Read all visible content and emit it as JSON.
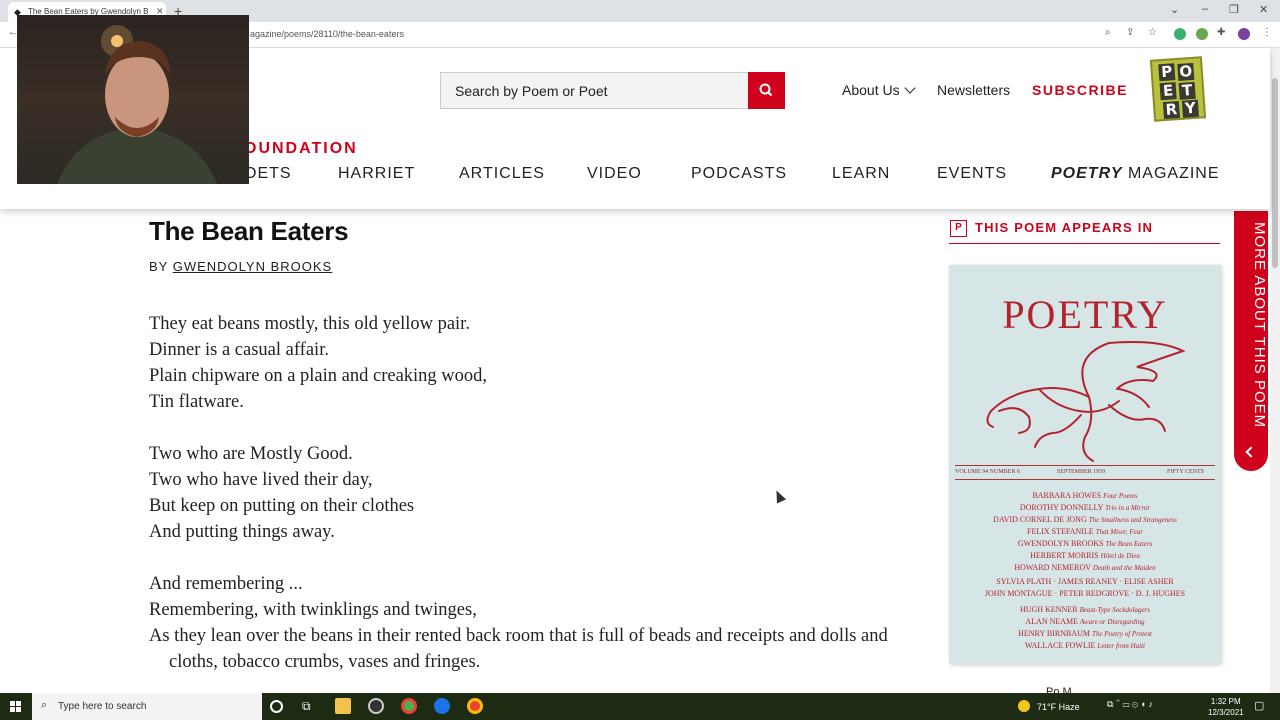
{
  "browser": {
    "tab_title": "The Bean Eaters by Gwendolyn B",
    "url": "agazine/poems/28110/the-bean-eaters"
  },
  "header": {
    "search_placeholder": "Search by Poem or Poet",
    "about_us": "About Us",
    "newsletters": "Newsletters",
    "subscribe": "SUBSCRIBE",
    "logo_letters": [
      "P",
      "O",
      "E",
      "T",
      "R",
      "Y"
    ],
    "foundation_fragment": "OUNDATION",
    "nav": {
      "poets_fragment": "OETS",
      "harriet": "HARRIET",
      "articles": "ARTICLES",
      "video": "VIDEO",
      "podcasts": "PODCASTS",
      "learn": "LEARN",
      "events": "EVENTS",
      "poetry_magazine_em": "POETRY",
      "poetry_magazine_rest": " MAGAZINE"
    }
  },
  "poem": {
    "title": "The Bean Eaters",
    "by": "BY ",
    "author": "GWENDOLYN BROOKS",
    "lines": [
      "They eat beans mostly, this old yellow pair.",
      "Dinner is a casual affair.",
      "Plain chipware on a plain and creaking wood,",
      "Tin flatware.",
      "Two who are Mostly Good.",
      "Two who have lived their day,",
      "But keep on putting on their clothes",
      "And putting things away.",
      "And remembering ...",
      "Remembering, with twinklings and twinges,",
      "As they lean over the beans in their rented back room that is full of beads and receipts and dolls and",
      "cloths, tobacco crumbs, vases and fringes."
    ]
  },
  "sidebar": {
    "icon_letter": "P",
    "appears_in": "THIS POEM APPEARS IN",
    "side_tab": "MORE ABOUT THIS POEM",
    "peek_text": "Po  M",
    "cover": {
      "title": "POETRY",
      "volume": "VOLUME 94   NUMBER 6",
      "date": "SEPTEMBER 1959",
      "price": "FIFTY CENTS",
      "toc": [
        {
          "name": "BARBARA HOWES",
          "work": "Four Poems"
        },
        {
          "name": "DOROTHY DONNELLY",
          "work": "Trio in a Mirror"
        },
        {
          "name": "DAVID CORNEL DE JONG",
          "work": "The Smallness and Strangeness"
        },
        {
          "name": "FELIX STEFANILE",
          "work": "That Miser, Fear"
        },
        {
          "name": "GWENDOLYN BROOKS",
          "work": "The Bean Eaters"
        },
        {
          "name": "HERBERT MORRIS",
          "work": "Hôtel de Dieu"
        },
        {
          "name": "HOWARD NEMEROV",
          "work": "Death and the Maiden"
        },
        {
          "name": "SYLVIA PLATH · JAMES REANEY · ELISE ASHER",
          "work": ""
        },
        {
          "name": "JOHN MONTAGUE · PETER REDGROVE · D. J. HUGHES",
          "work": ""
        },
        {
          "name": "HUGH KENNER",
          "work": "Beast-Type Sockdolagers"
        },
        {
          "name": "ALAN NEAME",
          "work": "Aware or Disregarding"
        },
        {
          "name": "HENRY BIRNBAUM",
          "work": "The Poetry of Protest"
        },
        {
          "name": "WALLACE FOWLIE",
          "work": "Letter from Haiti"
        }
      ]
    }
  },
  "taskbar": {
    "search_placeholder": "Type here to search",
    "weather": "71°F  Haze",
    "time": "1:32 PM",
    "date": "12/3/2021"
  },
  "colors": {
    "brand_red": "#d0021b",
    "taskbar": "#1d2b12",
    "cover_bg": "#d6e6e6"
  }
}
